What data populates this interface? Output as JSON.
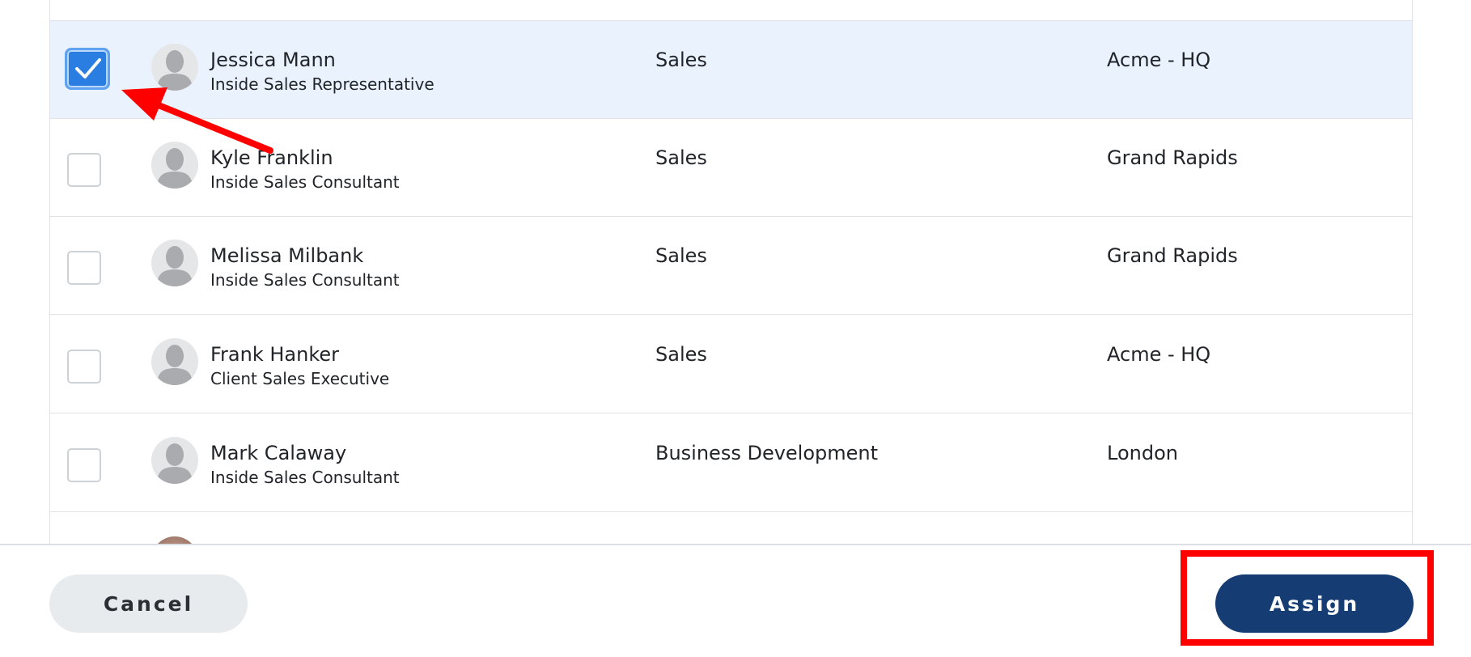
{
  "people": [
    {
      "name": "Jessica Mann",
      "role": "Inside Sales Representative",
      "department": "Sales",
      "location": "Acme - HQ",
      "selected": true
    },
    {
      "name": "Kyle Franklin",
      "role": "Inside Sales Consultant",
      "department": "Sales",
      "location": "Grand Rapids",
      "selected": false
    },
    {
      "name": "Melissa Milbank",
      "role": "Inside Sales Consultant",
      "department": "Sales",
      "location": "Grand Rapids",
      "selected": false
    },
    {
      "name": "Frank Hanker",
      "role": "Client Sales Executive",
      "department": "Sales",
      "location": "Acme - HQ",
      "selected": false
    },
    {
      "name": "Mark Calaway",
      "role": "Inside Sales Consultant",
      "department": "Business Development",
      "location": "London",
      "selected": false
    }
  ],
  "footer": {
    "cancel_label": "Cancel",
    "assign_label": "Assign"
  },
  "icons": {
    "avatar": "person-silhouette-icon",
    "checkbox": "check-icon"
  },
  "colors": {
    "selected_row": "#eaf3fd",
    "checkbox_checked": "#2a7de1",
    "assign_button": "#163d73",
    "annotation": "#ff0000"
  }
}
